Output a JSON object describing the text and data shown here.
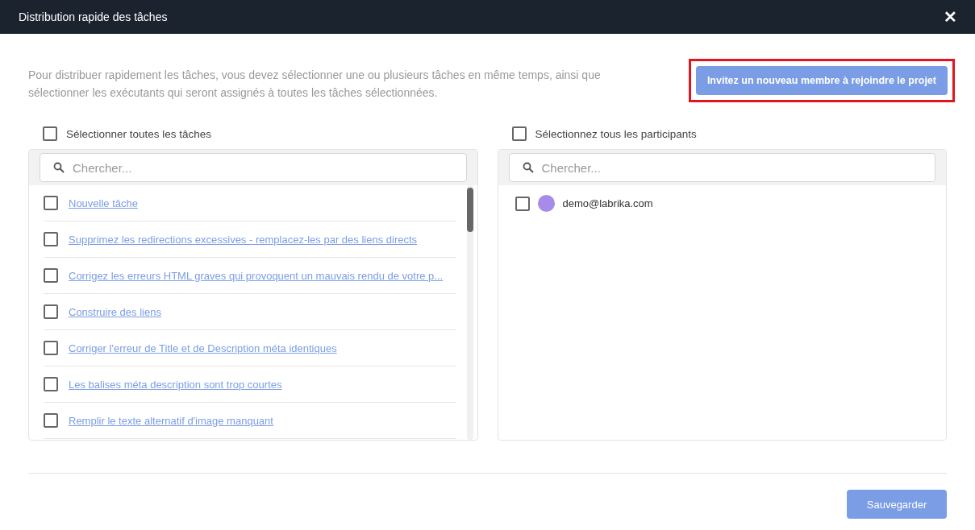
{
  "window": {
    "title": "Distribution rapide des tâches",
    "close": "✕"
  },
  "description": "Pour distribuer rapidement les tâches, vous devez sélectionner une ou plusieurs tâches en même temps, ainsi que sélectionner les exécutants qui seront assignés à toutes les tâches sélectionnées.",
  "invite_button": {
    "label": "Invitez un nouveau membre à rejoindre le projet",
    "highlighted": true
  },
  "tasks": {
    "select_all": {
      "label": "Sélectionner toutes les tâches",
      "checked": false
    },
    "search": {
      "placeholder": "Chercher..."
    },
    "items": [
      {
        "label": "Nouvelle tâche",
        "checked": false
      },
      {
        "label": "Supprimez les redirections excessives - remplacez-les par des liens directs",
        "checked": false
      },
      {
        "label": "Corrigez les erreurs HTML graves qui provoquent un mauvais rendu de votre p...",
        "checked": false
      },
      {
        "label": "Construire des liens",
        "checked": false
      },
      {
        "label": "Corriger l'erreur de Title et de Description méta identiques",
        "checked": false
      },
      {
        "label": "Les balises méta description sont trop courtes",
        "checked": false
      },
      {
        "label": "Remplir le texte alternatif d'image manquant",
        "checked": false
      }
    ]
  },
  "participants": {
    "select_all": {
      "label": "Sélectionnez tous les participants",
      "checked": false
    },
    "search": {
      "placeholder": "Chercher..."
    },
    "items": [
      {
        "label": "demo@labrika.com",
        "checked": false
      }
    ]
  },
  "save_button": {
    "label": "Sauvegarder"
  }
}
